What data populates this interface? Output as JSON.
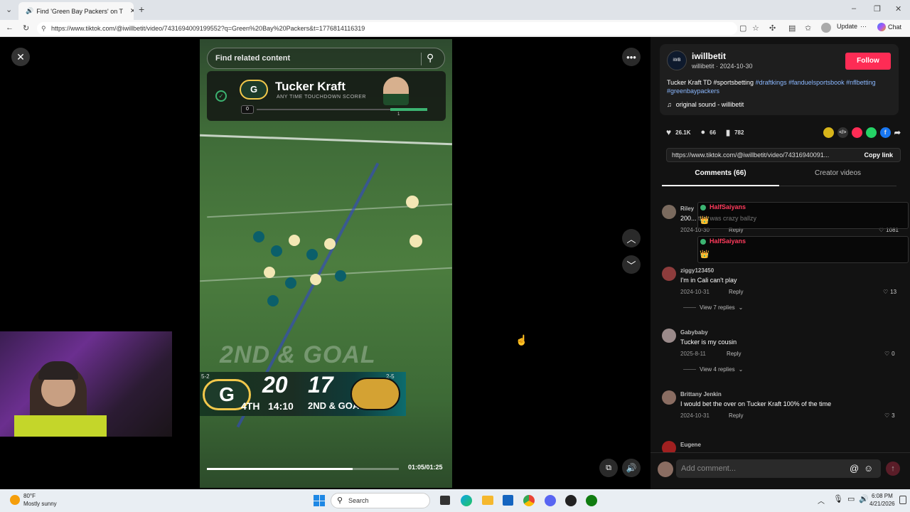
{
  "browser": {
    "tab_title": "Find 'Green Bay Packers' on T",
    "url": "https://www.tiktok.com/@iwillbetit/video/7431694009199552?q=Green%20Bay%20Packers&t=1776814116319",
    "update_label": "Update",
    "chat_label": "Chat"
  },
  "video": {
    "search_placeholder": "Find related content",
    "player_name": "Tucker Kraft",
    "player_subtitle": "ANY TIME TOUCHDOWN SCORER",
    "progress_start": "0",
    "progress_mark": "1",
    "endzone_text": "2ND & GOAL",
    "score": {
      "home": "20",
      "away": "17",
      "quarter": "4TH",
      "clock": "14:10",
      "down": "2ND & GOAL",
      "home_record": "5-2",
      "away_record": "2-5"
    },
    "time": "01:05/01:25",
    "progress": 0.76
  },
  "post": {
    "username": "iwillbetit",
    "handle_date": "willibetit · 2024-10-30",
    "follow_label": "Follow",
    "caption_plain": "Tucker Kraft TD #sportsbetting ",
    "caption_tags": "#draftkings #fanduelsportsbook #nflbetting #greenbaypackers",
    "sound": "original sound - willibetit",
    "likes": "26.1K",
    "comments": "66",
    "saves": "782",
    "link_text": "https://www.tiktok.com/@iwillbetit/video/74316940091...",
    "copy_label": "Copy link",
    "tab_comments": "Comments (66)",
    "tab_creator": "Creator videos"
  },
  "comments": [
    {
      "user": "Riley",
      "text": "200... this was crazy ballzy",
      "date": "2024-10-30",
      "reply": "Reply",
      "likes": "1081",
      "overlay": "HalfSaiyans"
    },
    {
      "user": "ziggy123450",
      "text": "I'm in Cali can't play",
      "date": "2024-10-31",
      "reply": "Reply",
      "likes": "13",
      "view": "View 7 replies"
    },
    {
      "user": "Gabybaby",
      "text": "Tucker is my cousin",
      "date": "2025-8-11",
      "reply": "Reply",
      "likes": "0",
      "view": "View 4 replies"
    },
    {
      "user": "Brittany Jenkin",
      "text": "I would bet the over on Tucker Kraft 100% of the time",
      "date": "2024-10-31",
      "reply": "Reply",
      "likes": "3"
    },
    {
      "user": "Eugene"
    }
  ],
  "overlay2": "HalfSaiyans",
  "add_comment_placeholder": "Add comment...",
  "taskbar": {
    "temp": "80°F",
    "weather": "Mostly sunny",
    "search": "Search",
    "time": "6:08 PM",
    "date": "4/21/2026"
  }
}
